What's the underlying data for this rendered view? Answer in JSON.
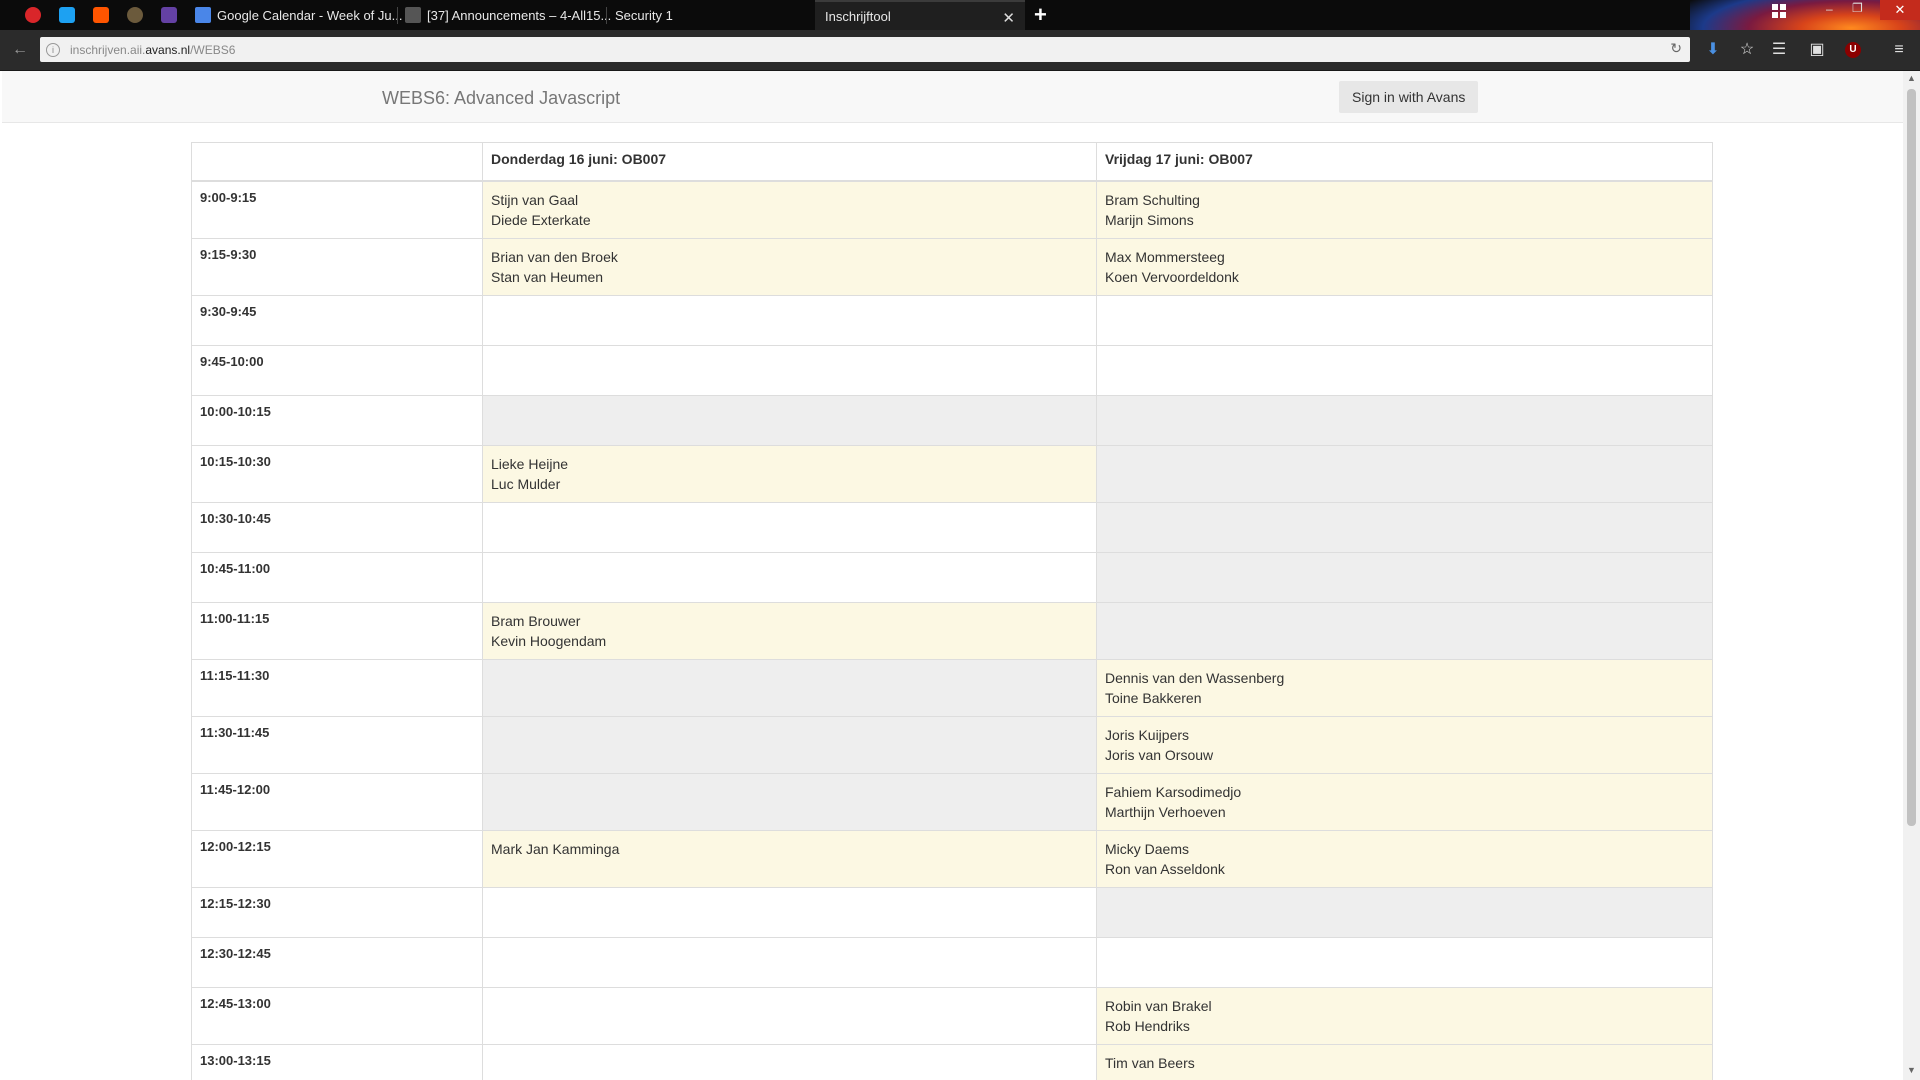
{
  "browser": {
    "tabs": [
      {
        "title": "Google Calendar - Week of Ju..."
      },
      {
        "title": "[37] Announcements – 4-All15..."
      },
      {
        "title": "Security 1"
      },
      {
        "title": "Inschrijftool"
      }
    ],
    "new_tab_label": "+",
    "close_tab_label": "✕",
    "url": {
      "pre": "inschrijven.aii.",
      "host": "avans.nl",
      "path": "/WEBS6"
    },
    "icons": [
      "back-icon",
      "info-icon",
      "reload-icon",
      "download-icon",
      "bookmark-star-icon",
      "reading-list-icon",
      "screenshot-icon",
      "ublock-icon",
      "menu-icon"
    ],
    "colors": {
      "tabbar": "#0b0b0b",
      "toolbar": "#2b2b2b",
      "urlbar": "#f1f1f1"
    }
  },
  "navbar": {
    "brand": "WEBS6: Advanced Javascript",
    "signin_label": "Sign in with Avans"
  },
  "schedule": {
    "columns": [
      "",
      "Donderdag 16 juni: OB007",
      "Vrijdag 17 juni: OB007"
    ],
    "rows": [
      {
        "time": "9:00-9:15",
        "day1": {
          "state": "filled",
          "names": [
            "Stijn van Gaal",
            "Diede Exterkate"
          ]
        },
        "day2": {
          "state": "filled",
          "names": [
            "Bram Schulting",
            "Marijn Simons"
          ]
        }
      },
      {
        "time": "9:15-9:30",
        "day1": {
          "state": "filled",
          "names": [
            "Brian van den Broek",
            "Stan van Heumen"
          ]
        },
        "day2": {
          "state": "filled",
          "names": [
            "Max Mommersteeg",
            "Koen Vervoordeldonk"
          ]
        }
      },
      {
        "time": "9:30-9:45",
        "day1": {
          "state": "open",
          "names": []
        },
        "day2": {
          "state": "open",
          "names": []
        }
      },
      {
        "time": "9:45-10:00",
        "day1": {
          "state": "open",
          "names": []
        },
        "day2": {
          "state": "open",
          "names": []
        }
      },
      {
        "time": "10:00-10:15",
        "day1": {
          "state": "unavailable",
          "names": []
        },
        "day2": {
          "state": "unavailable",
          "names": []
        }
      },
      {
        "time": "10:15-10:30",
        "day1": {
          "state": "filled",
          "names": [
            "Lieke Heijne",
            "Luc Mulder"
          ]
        },
        "day2": {
          "state": "unavailable",
          "names": []
        }
      },
      {
        "time": "10:30-10:45",
        "day1": {
          "state": "open",
          "names": []
        },
        "day2": {
          "state": "unavailable",
          "names": []
        }
      },
      {
        "time": "10:45-11:00",
        "day1": {
          "state": "open",
          "names": []
        },
        "day2": {
          "state": "unavailable",
          "names": []
        }
      },
      {
        "time": "11:00-11:15",
        "day1": {
          "state": "filled",
          "names": [
            "Bram Brouwer",
            "Kevin Hoogendam"
          ]
        },
        "day2": {
          "state": "unavailable",
          "names": []
        }
      },
      {
        "time": "11:15-11:30",
        "day1": {
          "state": "unavailable",
          "names": []
        },
        "day2": {
          "state": "filled",
          "names": [
            "Dennis van den Wassenberg",
            "Toine Bakkeren"
          ]
        }
      },
      {
        "time": "11:30-11:45",
        "day1": {
          "state": "unavailable",
          "names": []
        },
        "day2": {
          "state": "filled",
          "names": [
            "Joris Kuijpers",
            "Joris van Orsouw"
          ]
        }
      },
      {
        "time": "11:45-12:00",
        "day1": {
          "state": "unavailable",
          "names": []
        },
        "day2": {
          "state": "filled",
          "names": [
            "Fahiem Karsodimedjo",
            "Marthijn Verhoeven"
          ]
        }
      },
      {
        "time": "12:00-12:15",
        "day1": {
          "state": "filled",
          "names": [
            "Mark Jan Kamminga"
          ]
        },
        "day2": {
          "state": "filled",
          "names": [
            "Micky Daems",
            "Ron van Asseldonk"
          ]
        }
      },
      {
        "time": "12:15-12:30",
        "day1": {
          "state": "open",
          "names": []
        },
        "day2": {
          "state": "unavailable",
          "names": []
        }
      },
      {
        "time": "12:30-12:45",
        "day1": {
          "state": "open",
          "names": []
        },
        "day2": {
          "state": "open",
          "names": []
        }
      },
      {
        "time": "12:45-13:00",
        "day1": {
          "state": "open",
          "names": []
        },
        "day2": {
          "state": "filled",
          "names": [
            "Robin van Brakel",
            "Rob Hendriks"
          ]
        }
      },
      {
        "time": "13:00-13:15",
        "day1": {
          "state": "open",
          "names": []
        },
        "day2": {
          "state": "filled",
          "names": [
            "Tim van Beers"
          ]
        }
      }
    ],
    "colors": {
      "filled": "#fcf8e3",
      "open": "#ffffff",
      "unavailable": "#eeeeee",
      "border": "#dddddd"
    }
  }
}
